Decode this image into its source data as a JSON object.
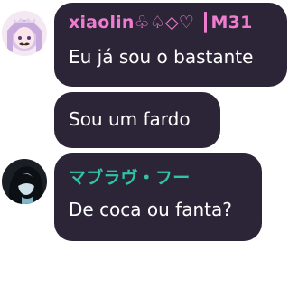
{
  "messages": [
    {
      "sender_name": "xiaolin♧♤◇♡ ┃M31",
      "sender_color": "#f07cd0",
      "text": "Eu já sou o bastante",
      "avatar": "anime-girl-avatar"
    },
    {
      "text": "Sou um fardo"
    },
    {
      "sender_name": "マブラヴ・フー",
      "sender_color": "#2ec4a8",
      "text": "De coca ou fanta?",
      "avatar": "dark-haired-figure-avatar"
    }
  ],
  "colors": {
    "bubble_background": "#2c2538",
    "message_text": "#ffffff"
  }
}
